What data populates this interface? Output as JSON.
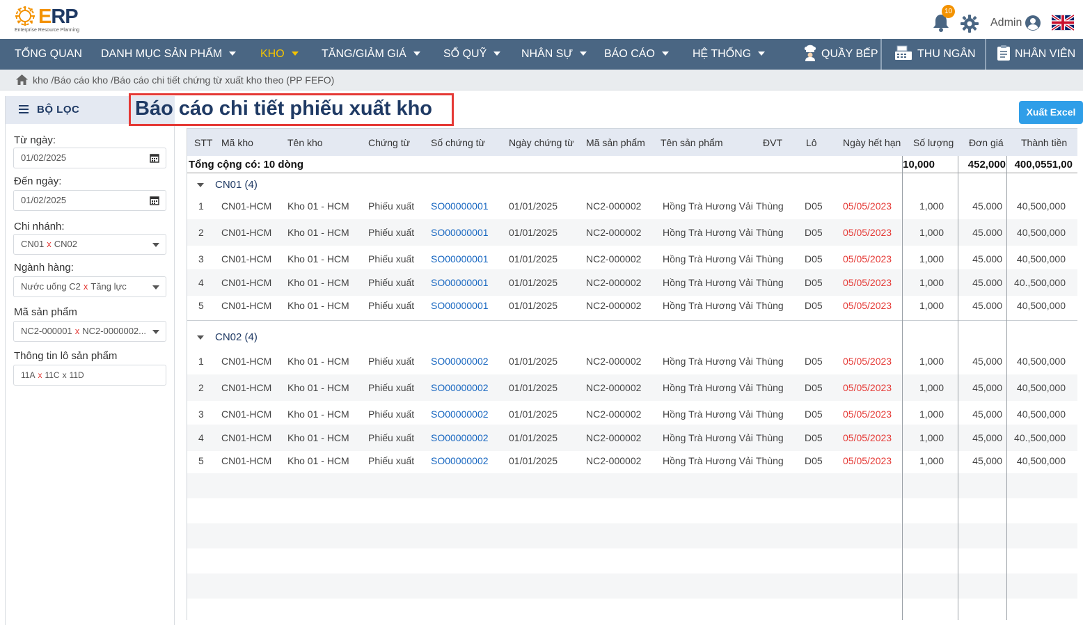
{
  "brand": {
    "logo_text_e": "E",
    "logo_text_rest": "RP",
    "tagline": "Enterprise Resource Planning"
  },
  "header": {
    "notification_count": "10",
    "user_name": "Admin"
  },
  "nav": {
    "items": [
      "TỔNG QUAN",
      "DANH MỤC SẢN PHẨM",
      "KHO",
      "TĂNG/GIẢM GIÁ",
      "SỔ QUỸ",
      "NHÂN SỰ",
      "BÁO CÁO",
      "HỆ THỐNG"
    ],
    "right": [
      "QUẦY BẾP",
      "THU NGÂN",
      "NHÂN VIÊN"
    ]
  },
  "breadcrumb": "kho /Báo cáo kho /Báo cáo chi tiết chứng từ xuất kho theo (PP FEFO)",
  "filter": {
    "title": "BỘ LỌC",
    "from_label": "Từ ngày:",
    "from_value": "01/02/2025",
    "to_label": "Đến ngày:",
    "to_value": "01/02/2025",
    "branch_label": "Chi nhánh:",
    "branch_a": "CN01",
    "branch_b": "CN02",
    "category_label": "Ngành hàng:",
    "category_a": "Nước uống C2",
    "category_b": "Tăng lực",
    "product_label": "Mã sản phẩm",
    "product_a": "NC2-000001",
    "product_b": "NC2-0000002...",
    "lot_label": "Thông tin lô sản phẩm",
    "lot_a": "11A",
    "lot_b": "11C",
    "lot_c": "11D",
    "separator": "x"
  },
  "page": {
    "title": "Báo cáo chi tiết phiếu xuất kho",
    "export_button": "Xuất Excel"
  },
  "table": {
    "columns": [
      "STT",
      "Mã kho",
      "Tên kho",
      "Chứng từ",
      "Số chứng từ",
      "Ngày chứng từ",
      "Mã sản phẩm",
      "Tên sản phẩm",
      "ĐVT",
      "Lô",
      "Ngày hết hạn",
      "Số lượng",
      "Đơn giá",
      "Thành tiền"
    ],
    "total_label": "Tổng cộng có: 10 dòng",
    "total_qty": "10,000",
    "total_price": "452,000",
    "total_amount": "400,0551,00",
    "groups": [
      {
        "label": "CN01 (4)",
        "rows": [
          [
            "1",
            "CN01-HCM",
            "Kho 01 - HCM",
            "Phiếu xuất",
            "SO00000001",
            "01/01/2025",
            "NC2-000002",
            "Hồng Trà Hương Vải",
            "Thùng",
            "D05",
            "05/05/2023",
            "1,000",
            "45.000",
            "40,500,000"
          ],
          [
            "2",
            "CN01-HCM",
            "Kho 01 - HCM",
            "Phiếu xuất",
            "SO00000001",
            "01/01/2025",
            "NC2-000002",
            "Hồng Trà Hương Vải",
            "Thùng",
            "D05",
            "05/05/2023",
            "1,000",
            "45.000",
            "40,500,000"
          ],
          [
            "3",
            "CN01-HCM",
            "Kho 01 - HCM",
            "Phiếu xuất",
            "SO00000001",
            "01/01/2025",
            "NC2-000002",
            "Hồng Trà Hương Vải",
            "Thùng",
            "D05",
            "05/05/2023",
            "1,000",
            "45.000",
            "40,500,000"
          ],
          [
            "4",
            "CN01-HCM",
            "Kho 01 - HCM",
            "Phiếu xuất",
            "SO00000001",
            "01/01/2025",
            "NC2-000002",
            "Hồng Trà Hương Vải",
            "Thùng",
            "D05",
            "05/05/2023",
            "1,000",
            "45.000",
            "40.,500,000"
          ],
          [
            "5",
            "CN01-HCM",
            "Kho 01 - HCM",
            "Phiếu xuất",
            "SO00000001",
            "01/01/2025",
            "NC2-000002",
            "Hồng Trà Hương Vải",
            "Thùng",
            "D05",
            "05/05/2023",
            "1,000",
            "45.000",
            "40,500,000"
          ]
        ]
      },
      {
        "label": "CN02 (4)",
        "rows": [
          [
            "1",
            "CN01-HCM",
            "Kho 01 - HCM",
            "Phiếu xuất",
            "SO00000002",
            "01/01/2025",
            "NC2-000002",
            "Hồng Trà Hương Vải",
            "Thùng",
            "D05",
            "05/05/2023",
            "1,000",
            "45,000",
            "40,500,000"
          ],
          [
            "2",
            "CN01-HCM",
            "Kho 01 - HCM",
            "Phiếu xuất",
            "SO00000002",
            "01/01/2025",
            "NC2-000002",
            "Hồng Trà Hương Vải",
            "Thùng",
            "D05",
            "05/05/2023",
            "1,000",
            "45,000",
            "40,500,000"
          ],
          [
            "3",
            "CN01-HCM",
            "Kho 01 - HCM",
            "Phiếu xuất",
            "SO00000002",
            "01/01/2025",
            "NC2-000002",
            "Hồng Trà Hương Vải",
            "Thùng",
            "D05",
            "05/05/2023",
            "1,000",
            "45,000",
            "40,500,000"
          ],
          [
            "4",
            "CN01-HCM",
            "Kho 01 - HCM",
            "Phiếu xuất",
            "SO00000002",
            "01/01/2025",
            "NC2-000002",
            "Hồng Trà Hương Vải",
            "Thùng",
            "D05",
            "05/05/2023",
            "1,000",
            "45,000",
            "40.,500,000"
          ],
          [
            "5",
            "CN01-HCM",
            "Kho 01 - HCM",
            "Phiếu xuất",
            "SO00000002",
            "01/01/2025",
            "NC2-000002",
            "Hồng Trà Hương Vải",
            "Thùng",
            "D05",
            "05/05/2023",
            "1,000",
            "45,000",
            "40,500,000"
          ]
        ]
      }
    ]
  },
  "colors": {
    "nav_bg": "#4a6683",
    "active_nav": "#f5c400",
    "accent": "#f39200",
    "link": "#1565c0",
    "expiry": "#e53935",
    "export_btn": "#2f9ee8"
  }
}
